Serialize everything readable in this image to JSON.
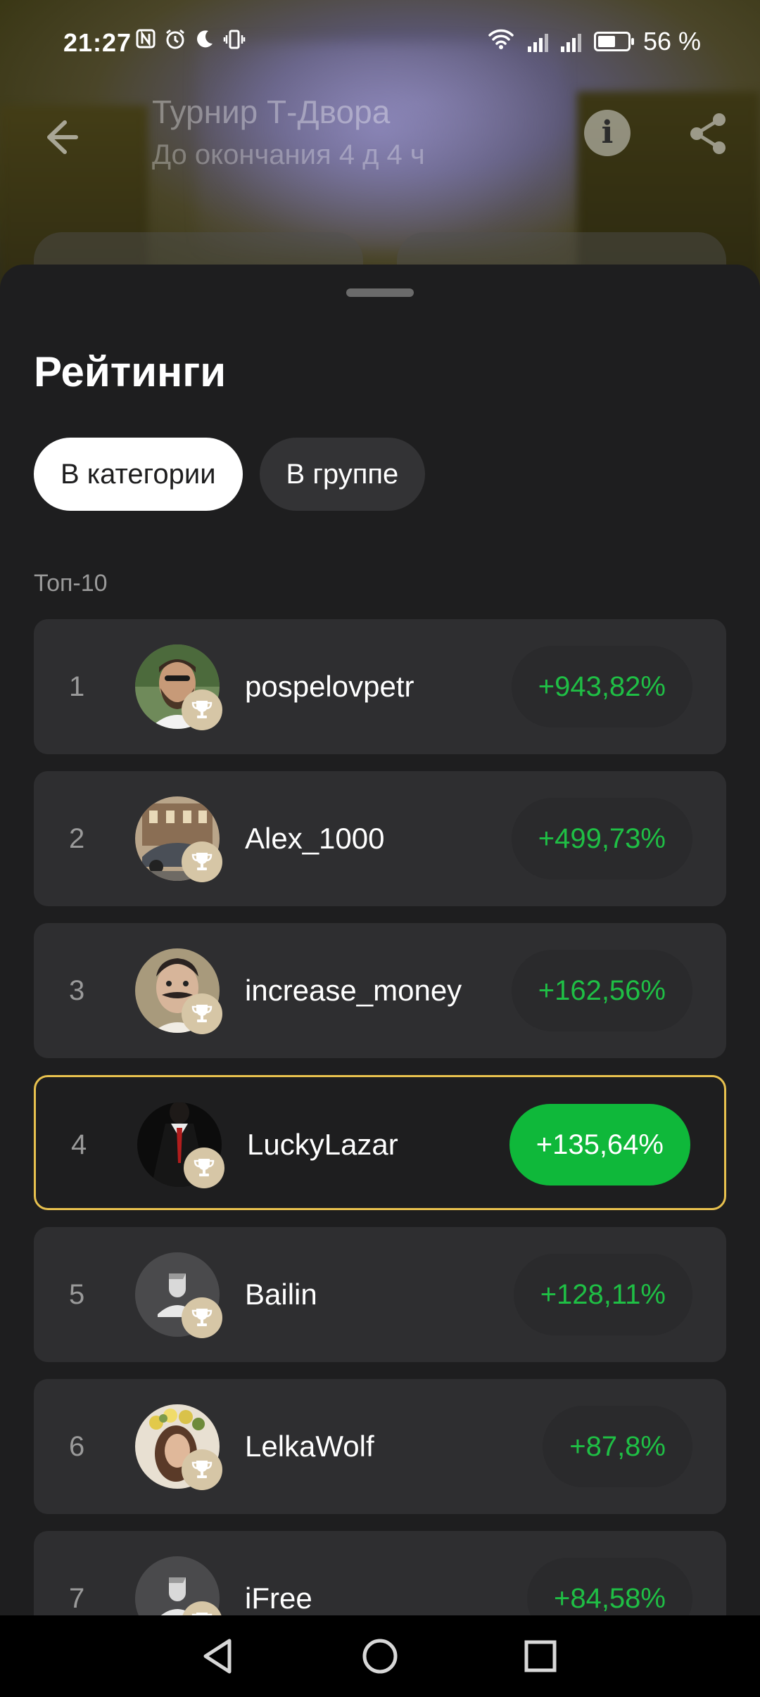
{
  "status_bar": {
    "time": "21:27",
    "battery": "56 %",
    "left_icons": [
      "nfc-icon",
      "alarm-icon",
      "moon-icon",
      "vibrate-icon"
    ],
    "right_icons": [
      "wifi-icon",
      "signal-icon",
      "signal-icon",
      "battery-icon"
    ]
  },
  "header": {
    "title": "Турнир Т-Двора",
    "subtitle": "До окончания 4 д 4 ч"
  },
  "sheet": {
    "title": "Рейтинги",
    "tabs": [
      {
        "label": "В категории",
        "active": true
      },
      {
        "label": "В группе",
        "active": false
      }
    ],
    "section_label": "Топ-10"
  },
  "ratings": [
    {
      "rank": "1",
      "name": "pospelovpetr",
      "pct": "+943,82%",
      "avatar": "photo-man-beard"
    },
    {
      "rank": "2",
      "name": "Alex_1000",
      "pct": "+499,73%",
      "avatar": "photo-car"
    },
    {
      "rank": "3",
      "name": "increase_money",
      "pct": "+162,56%",
      "avatar": "photo-man-mustache"
    },
    {
      "rank": "4",
      "name": "LuckyLazar",
      "pct": "+135,64%",
      "avatar": "photo-suit",
      "current_user": true
    },
    {
      "rank": "5",
      "name": "Bailin",
      "pct": "+128,11%",
      "avatar": "default-user"
    },
    {
      "rank": "6",
      "name": "LelkaWolf",
      "pct": "+87,8%",
      "avatar": "photo-woman-flowers"
    },
    {
      "rank": "7",
      "name": "iFree",
      "pct": "+84,58%",
      "avatar": "default-user"
    }
  ],
  "colors": {
    "accent_green": "#1fbf45",
    "highlight_border": "#e8c14e",
    "sheet_bg": "#1e1e1f",
    "row_bg": "#2e2e30"
  }
}
